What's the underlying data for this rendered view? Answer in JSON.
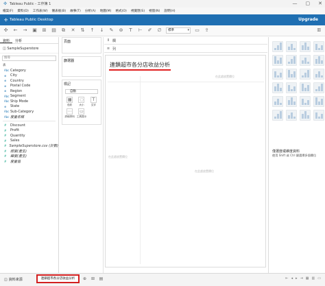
{
  "window": {
    "title": "Tableau Public - 工作簿 1",
    "controls": [
      "—",
      "▢",
      "✕"
    ]
  },
  "menu": [
    "檔案(F)",
    "資料(D)",
    "工作表(W)",
    "儀表板(B)",
    "故事(T)",
    "分析(A)",
    "地圖(M)",
    "格式(O)",
    "視覺匯(S)",
    "視窗(N)",
    "說明(H)"
  ],
  "brand": {
    "product": "Tableau Public Desktop",
    "upgrade": "Upgrade"
  },
  "toolbar": {
    "standard_select": "標準"
  },
  "datapane": {
    "tab_data": "資料",
    "tab_analysis": "分析",
    "source": "SampleSuperstore",
    "search_placeholder": "搜尋",
    "section_table": "表",
    "dimensions": [
      {
        "type": "Abc",
        "name": "Category"
      },
      {
        "type": "⊕",
        "name": "City"
      },
      {
        "type": "⊕",
        "name": "Country"
      },
      {
        "type": "⊕",
        "name": "Postal Code"
      },
      {
        "type": "⊕",
        "name": "Region"
      },
      {
        "type": "Abc",
        "name": "Segment"
      },
      {
        "type": "Abc",
        "name": "Ship Mode"
      },
      {
        "type": "⊕",
        "name": "State"
      },
      {
        "type": "Abc",
        "name": "Sub-Category"
      },
      {
        "type": "Abc",
        "name": "度量名稱"
      }
    ],
    "measures": [
      {
        "type": "#",
        "name": "Discount"
      },
      {
        "type": "#",
        "name": "Profit"
      },
      {
        "type": "#",
        "name": "Quantity"
      },
      {
        "type": "#",
        "name": "Sales"
      },
      {
        "type": "#",
        "name": "SampleSuperstore.csv (計數)"
      },
      {
        "type": "#",
        "name": "經度(產生)"
      },
      {
        "type": "#",
        "name": "緯度(產生)"
      },
      {
        "type": "#",
        "name": "度量值"
      }
    ]
  },
  "shelves": {
    "pages": "頁面",
    "filters": "篩選器",
    "marks": "標記",
    "marks_type": "自動",
    "mark_buttons": [
      {
        "icon": "▦",
        "label": "色彩"
      },
      {
        "icon": "◌",
        "label": "大小"
      },
      {
        "icon": "T",
        "label": "文字"
      },
      {
        "icon": "⋯",
        "label": "詳細資料"
      },
      {
        "icon": "▭",
        "label": "工具提示"
      }
    ],
    "columns": "欄",
    "rows": "列"
  },
  "view": {
    "sheet_title": "連鎖超市各分店收益分析",
    "drop_field_top": "在此處放置欄位",
    "drop_field_left": "在此處放置欄位",
    "drop_field_center": "在此處放置欄位",
    "drop_field_header": "在此處放置欄位"
  },
  "showme": {
    "title": "僅選度或維度資料",
    "hint": "使用 Shift 或 Ctrl 鍵選擇多個欄位"
  },
  "bottom": {
    "datasource_tab": "資料來源",
    "sheet_tab": "連鎖超市各分店收益分析"
  },
  "colors": {
    "brand_blue": "#1f6fb2",
    "highlight_red": "#e02020"
  }
}
